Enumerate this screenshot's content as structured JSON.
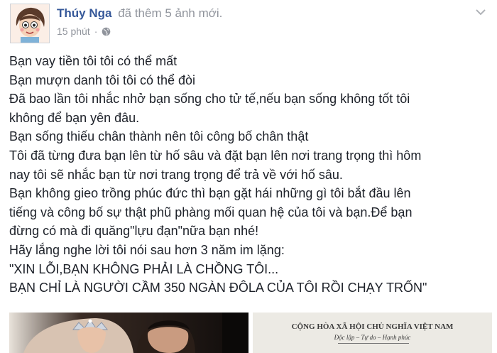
{
  "post": {
    "author": "Thúy Nga",
    "action": "đã thêm 5 ảnh mới.",
    "time": "15 phút",
    "separator": "·",
    "privacy_icon": "globe-icon",
    "menu_icon": "chevron-down-icon",
    "avatar_icon": "cartoon-avatar",
    "lines": [
      "Bạn vay tiền tôi tôi có thể mất",
      "Bạn mượn danh tôi tôi có thể đòi",
      "Đã bao lần tôi nhắc nhở bạn sống cho tử tế,nếu bạn sống không tốt tôi",
      "không để bạn yên đâu.",
      "Bạn sống thiếu chân thành nên tôi công bố chân thật",
      "Tôi đã từng đưa bạn lên từ hố sâu và đặt bạn lên nơi trang trọng thì hôm",
      "nay tôi sẽ nhắc bạn từ nơi trang trọng để trả về với hố sâu.",
      "Bạn không gieo trồng phúc đức thì bạn gặt hái những gì tôi bắt đầu lên",
      "tiếng và công bố sự thật phũ phàng mối quan hệ của tôi và bạn.Để bạn",
      "đừng có mà đi quăng\"lựu đạn\"nữa bạn nhé!",
      "Hãy lắng nghe lời tôi nói sau hơn 3 năm im lặng:",
      "\"XIN LỖI,BẠN KHÔNG PHẢI LÀ CHỒNG TÔI...",
      "BẠN CHỈ LÀ NGƯỜI CẦM 350 NGÀN ĐÔLA CỦA TÔI RỒI CHẠY TRỐN\""
    ]
  },
  "photos": [
    {
      "kind": "wedding-photo"
    },
    {
      "kind": "document-scan",
      "header": "CỘNG HÒA XÃ HỘI CHỦ NGHĨA VIỆT NAM",
      "subheader": "Độc lập – Tự do – Hạnh phúc"
    }
  ],
  "colors": {
    "link": "#365899",
    "secondary": "#90949c",
    "text": "#1d2129"
  }
}
